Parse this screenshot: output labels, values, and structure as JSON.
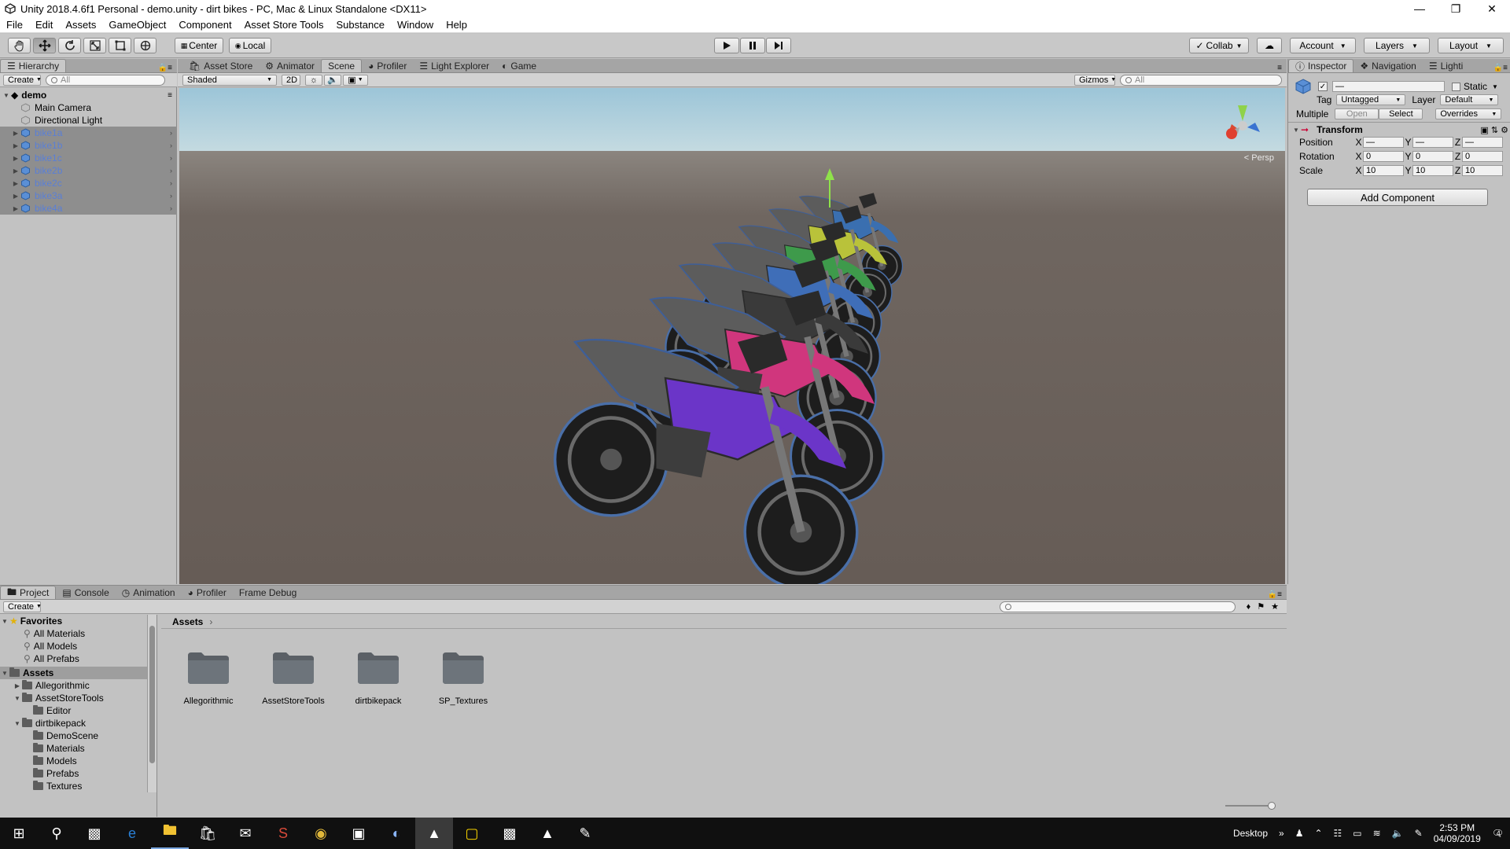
{
  "window": {
    "title": "Unity 2018.4.6f1 Personal - demo.unity - dirt bikes - PC, Mac & Linux Standalone <DX11>"
  },
  "menu": [
    "File",
    "Edit",
    "Assets",
    "GameObject",
    "Component",
    "Asset Store Tools",
    "Substance",
    "Window",
    "Help"
  ],
  "toolbar": {
    "pivot": "Center",
    "space": "Local",
    "collab": "Collab",
    "account": "Account",
    "layers": "Layers",
    "layout": "Layout",
    "tools": [
      "hand-tool",
      "move-tool",
      "rotate-tool",
      "scale-tool",
      "rect-tool",
      "transform-tool"
    ],
    "active_tool": "move-tool"
  },
  "hierarchy": {
    "tab": "Hierarchy",
    "create": "Create",
    "search_placeholder": "All",
    "scene": "demo",
    "items": [
      {
        "label": "Main Camera",
        "selected": false
      },
      {
        "label": "Directional Light",
        "selected": false
      },
      {
        "label": "bike1a",
        "selected": true
      },
      {
        "label": "bike1b",
        "selected": true
      },
      {
        "label": "bike1c",
        "selected": true
      },
      {
        "label": "bike2b",
        "selected": true
      },
      {
        "label": "bike2c",
        "selected": true
      },
      {
        "label": "bike3a",
        "selected": true
      },
      {
        "label": "bike4a",
        "selected": true
      }
    ]
  },
  "scene_view": {
    "tabs": [
      {
        "label": "Asset Store",
        "icon": "bag-icon"
      },
      {
        "label": "Animator",
        "icon": "animator-icon"
      },
      {
        "label": "Scene",
        "icon": "",
        "active": true
      },
      {
        "label": "Profiler",
        "icon": "profiler-icon"
      },
      {
        "label": "Light Explorer",
        "icon": "list-icon"
      },
      {
        "label": "Game",
        "icon": "game-icon"
      }
    ],
    "shading": "Shaded",
    "mode2d": "2D",
    "gizmos": "Gizmos",
    "search_placeholder": "All",
    "persp": "< Persp",
    "colors": {
      "sky": "#b9d5e0",
      "ground": "#6b625c"
    },
    "bikes": [
      {
        "color": "#3a6fb0"
      },
      {
        "color": "#b9c23a"
      },
      {
        "color": "#3e9a4b"
      },
      {
        "color": "#3f6eb8"
      },
      {
        "color": "#3a3a3a"
      },
      {
        "color": "#d0367d"
      },
      {
        "color": "#6b35c8"
      }
    ]
  },
  "inspector": {
    "tabs": [
      {
        "label": "Inspector",
        "active": true
      },
      {
        "label": "Navigation"
      },
      {
        "label": "Lighti"
      }
    ],
    "name_value": "—",
    "static_label": "Static",
    "tag_label": "Tag",
    "tag_value": "Untagged",
    "layer_label": "Layer",
    "layer_value": "Default",
    "multiple_label": "Multiple",
    "open": "Open",
    "select": "Select",
    "overrides": "Overrides",
    "transform_title": "Transform",
    "rows": [
      {
        "label": "Position",
        "x": "—",
        "y": "—",
        "z": "—"
      },
      {
        "label": "Rotation",
        "x": "0",
        "y": "0",
        "z": "0"
      },
      {
        "label": "Scale",
        "x": "10",
        "y": "10",
        "z": "10"
      }
    ],
    "axis_x": "X",
    "axis_y": "Y",
    "axis_z": "Z",
    "add_component": "Add Component"
  },
  "bottom": {
    "tabs": [
      {
        "label": "Project",
        "active": true
      },
      {
        "label": "Console"
      },
      {
        "label": "Animation"
      },
      {
        "label": "Profiler"
      },
      {
        "label": "Frame Debug"
      }
    ],
    "create": "Create",
    "favorites_label": "Favorites",
    "favorites": [
      "All Materials",
      "All Models",
      "All Prefabs"
    ],
    "assets_label": "Assets",
    "tree": [
      {
        "label": "Allegorithmic",
        "depth": 1,
        "expanded": false
      },
      {
        "label": "AssetStoreTools",
        "depth": 1,
        "expanded": true
      },
      {
        "label": "Editor",
        "depth": 2
      },
      {
        "label": "dirtbikepack",
        "depth": 1,
        "expanded": true
      },
      {
        "label": "DemoScene",
        "depth": 2
      },
      {
        "label": "Materials",
        "depth": 2
      },
      {
        "label": "Models",
        "depth": 2
      },
      {
        "label": "Prefabs",
        "depth": 2
      },
      {
        "label": "Textures",
        "depth": 2
      }
    ],
    "breadcrumb": "Assets",
    "folders": [
      "Allegorithmic",
      "AssetStoreTools",
      "dirtbikepack",
      "SP_Textures"
    ]
  },
  "taskbar": {
    "desktop": "Desktop",
    "time": "2:53 PM",
    "date": "04/09/2019",
    "notification_count": "4",
    "apps": [
      "windows-start-icon",
      "search-icon",
      "task-view-icon",
      "edge-icon",
      "file-explorer-icon",
      "store-icon",
      "mail-icon",
      "substance-icon",
      "chrome-icon",
      "app-icon",
      "eclipse-icon",
      "unity-icon",
      "sticky-notes-icon",
      "app2-icon",
      "photos-icon",
      "paint-icon"
    ]
  }
}
